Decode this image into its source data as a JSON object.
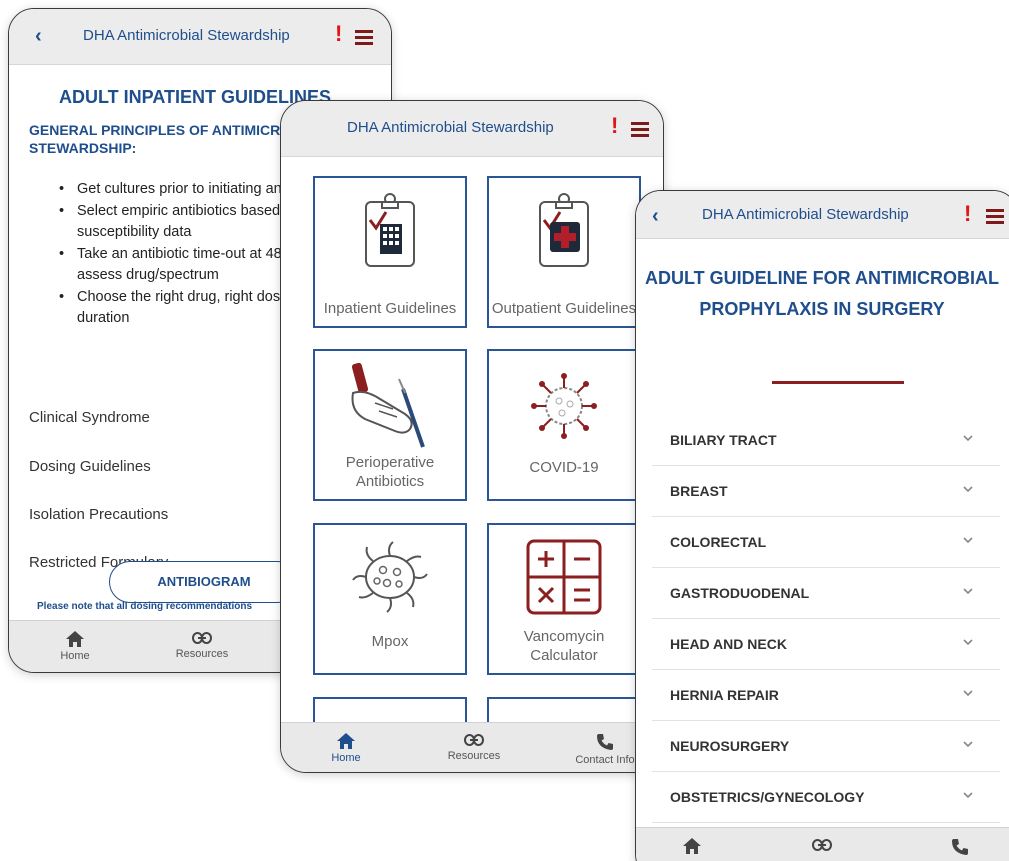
{
  "app_title": "DHA Antimicrobial Stewardship",
  "alert_glyph": "!",
  "colors": {
    "brand_blue": "#1f4e8c",
    "accent_red": "#8b1e1e",
    "alert_red": "#e01515"
  },
  "screen_inpatient": {
    "heading": "ADULT INPATIENT GUIDELINES",
    "subheading": "GENERAL PRINCIPLES OF ANTIMICROBIAL STEWARDSHIP:",
    "bullets": [
      "Get cultures prior to initiating antimicrobials",
      "Select empiric antibiotics based on local susceptibility data",
      "Take an antibiotic time-out at 48-72 hours to assess drug/spectrum",
      "Choose the right drug, right dose, right duration"
    ],
    "links": [
      "Clinical Syndrome",
      "Dosing Guidelines",
      "Isolation Precautions",
      "Restricted Formulary"
    ],
    "antibiogram_button": "ANTIBIOGRAM",
    "note": "Please note that all dosing recommendations",
    "nav": [
      "Home",
      "Resources"
    ]
  },
  "screen_home": {
    "tiles": [
      {
        "label": "Inpatient Guidelines",
        "icon": "clipboard-building-icon"
      },
      {
        "label": "Outpatient Guidelines",
        "icon": "clipboard-medical-cross-icon"
      },
      {
        "label": "Perioperative Antibiotics",
        "icon": "gloved-hand-scalpel-icon"
      },
      {
        "label": "COVID-19",
        "icon": "coronavirus-icon"
      },
      {
        "label": "Mpox",
        "icon": "virus-icon"
      },
      {
        "label": "Vancomycin Calculator",
        "icon": "calculator-icon"
      }
    ],
    "nav": [
      "Home",
      "Resources",
      "Contact Info"
    ]
  },
  "screen_prophylaxis": {
    "heading": "ADULT GUIDELINE FOR ANTIMICROBIAL PROPHYLAXIS IN SURGERY",
    "sections": [
      "BILIARY TRACT",
      "BREAST",
      "COLORECTAL",
      "GASTRODUODENAL",
      "HEAD AND NECK",
      "HERNIA REPAIR",
      "NEUROSURGERY",
      "OBSTETRICS/GYNECOLOGY"
    ]
  }
}
